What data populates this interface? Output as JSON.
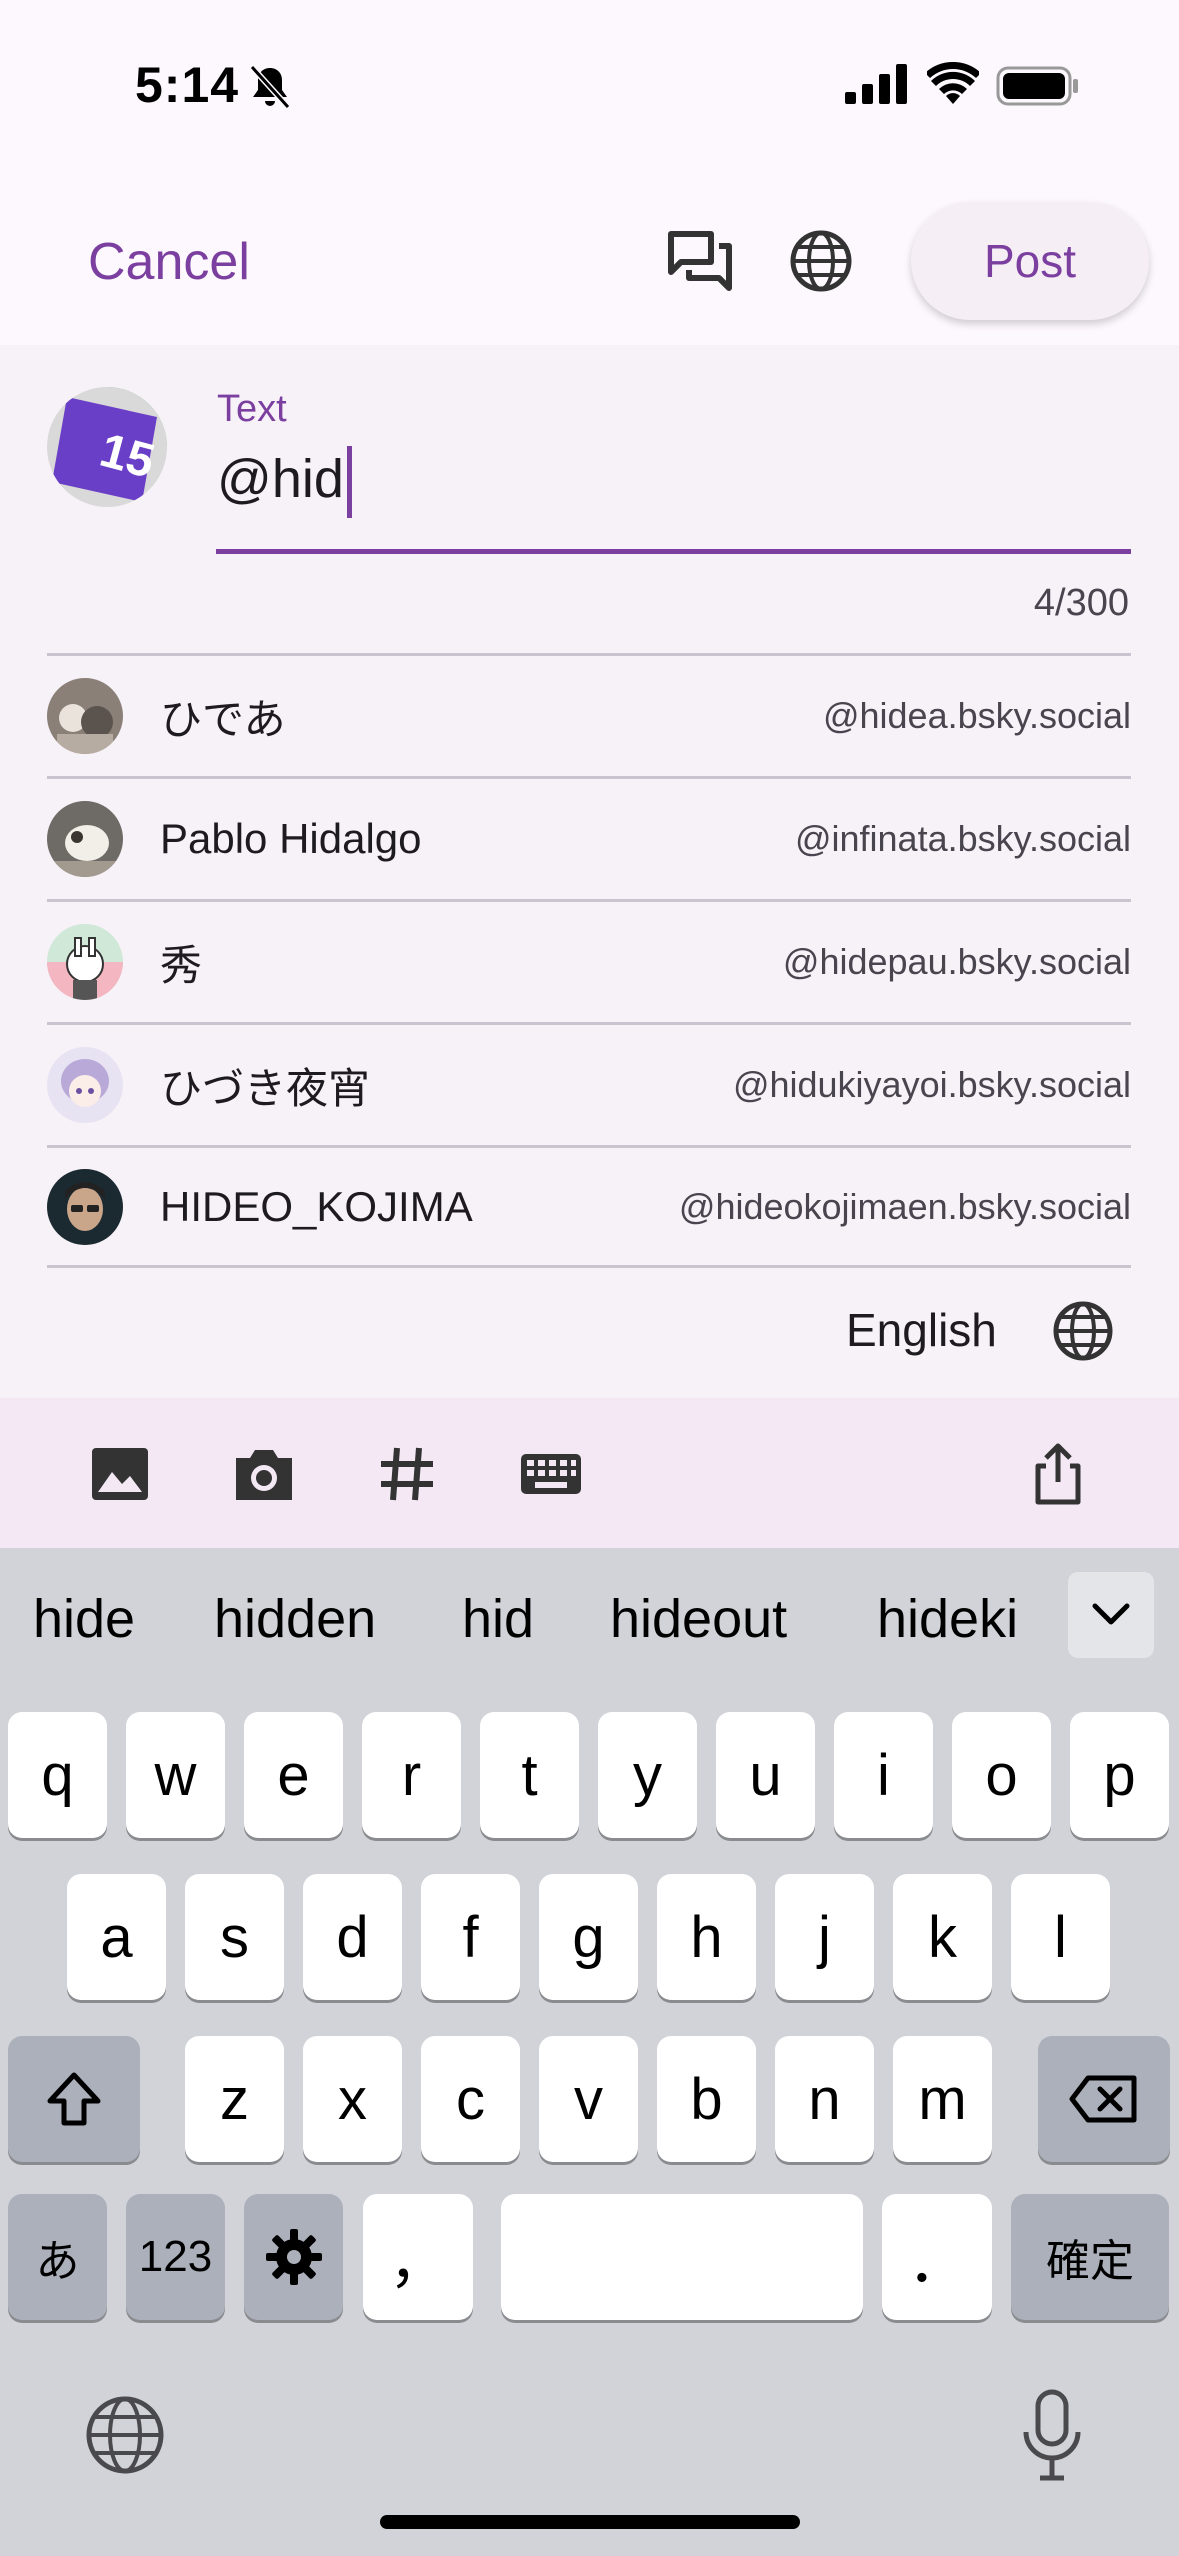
{
  "status_bar": {
    "time": "5:14"
  },
  "header": {
    "cancel_label": "Cancel",
    "post_label": "Post"
  },
  "compose": {
    "field_label": "Text",
    "field_value": "@hid",
    "counter": "4/300",
    "language": "English"
  },
  "suggestions": [
    {
      "name": "ひであ",
      "handle": "@hidea.bsky.social"
    },
    {
      "name": "Pablo Hidalgo",
      "handle": "@infinata.bsky.social"
    },
    {
      "name": "秀",
      "handle": "@hidepau.bsky.social"
    },
    {
      "name": "ひづき夜宵",
      "handle": "@hidukiyayoi.bsky.social"
    },
    {
      "name": "HIDEO_KOJIMA",
      "handle": "@hideokojimaen.bsky.social"
    }
  ],
  "avatar_me": {
    "number": "15"
  },
  "toolbar": {
    "icons": [
      "image-icon",
      "camera-icon",
      "hashtag-icon",
      "keyboard-icon",
      "share-icon"
    ]
  },
  "keyboard": {
    "predictions": [
      "hide",
      "hidden",
      "hid",
      "hideout",
      "hideki"
    ],
    "row1": [
      "q",
      "w",
      "e",
      "r",
      "t",
      "y",
      "u",
      "i",
      "o",
      "p"
    ],
    "row2": [
      "a",
      "s",
      "d",
      "f",
      "g",
      "h",
      "j",
      "k",
      "l"
    ],
    "row3": [
      "z",
      "x",
      "c",
      "v",
      "b",
      "n",
      "m"
    ],
    "bottom": {
      "kana": "あ",
      "numbers": "123",
      "comma": "，",
      "period": "．",
      "confirm": "確定"
    }
  },
  "colors": {
    "accent": "#7b3fa0",
    "background": "#fdf8fd",
    "compose_bg": "#f7f1f8",
    "toolbar_bg": "#f3e8f4",
    "keyboard_bg": "#d1d3d9"
  }
}
